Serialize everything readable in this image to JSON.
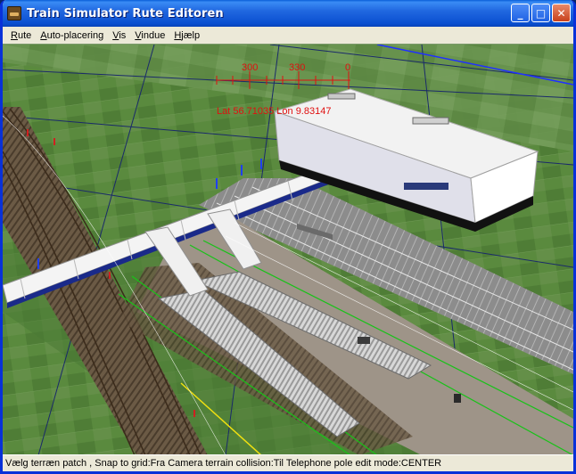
{
  "window": {
    "title": "Train Simulator Rute Editoren",
    "minimize_glyph": "_",
    "maximize_glyph": "□",
    "close_glyph": "✕"
  },
  "menu": {
    "items": [
      "Rute",
      "Auto-placering",
      "Vis",
      "Vindue",
      "Hjælp"
    ]
  },
  "compass": {
    "left": "300",
    "center": "330",
    "right": "0",
    "readout": "Lat 56.71035 Lon 9.83147"
  },
  "status": {
    "text": "Vælg terræn patch , Snap to grid:Fra Camera terrain collision:Til Telephone pole edit mode:CENTER"
  },
  "colors": {
    "titlebar": "#2168e0",
    "terrain": "#4e7a38",
    "compass": "#e01010",
    "track_green": "#19c219"
  }
}
